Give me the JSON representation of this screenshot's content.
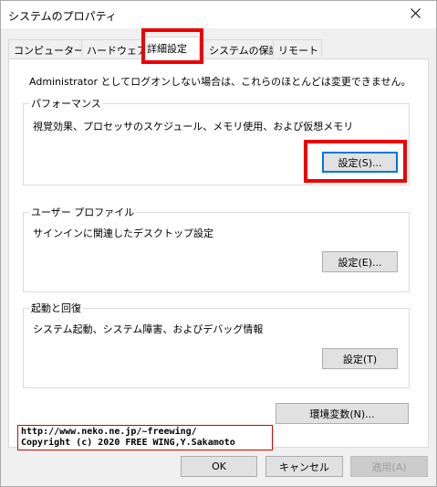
{
  "window": {
    "title": "システムのプロパティ",
    "close_glyph": "✕"
  },
  "tabs": [
    {
      "label": "コンピューター名"
    },
    {
      "label": "ハードウェア"
    },
    {
      "label": "詳細設定",
      "active": true
    },
    {
      "label": "システムの保護"
    },
    {
      "label": "リモート"
    }
  ],
  "panel": {
    "intro": "Administrator としてログオンしない場合は、これらのほとんどは変更できません。",
    "performance": {
      "label": "パフォーマンス",
      "desc": "視覚効果、プロセッサのスケジュール、メモリ使用、および仮想メモリ",
      "button": "設定(S)..."
    },
    "user_profile": {
      "label": "ユーザー プロファイル",
      "desc": "サインインに関連したデスクトップ設定",
      "button": "設定(E)..."
    },
    "startup": {
      "label": "起動と回復",
      "desc": "システム起動、システム障害、およびデバッグ情報",
      "button": "設定(T)"
    },
    "env_button": "環境変数(N)..."
  },
  "footer": {
    "ok": "OK",
    "cancel": "キャンセル",
    "apply": "適用(A)"
  },
  "watermark": {
    "line1": "http://www.neko.ne.jp/~freewing/",
    "line2": "Copyright (c) 2020 FREE WING,Y.Sakamoto"
  },
  "colors": {
    "highlight": "#ee0000",
    "focus": "#0078d7",
    "window_bg": "#f0f0f0"
  }
}
